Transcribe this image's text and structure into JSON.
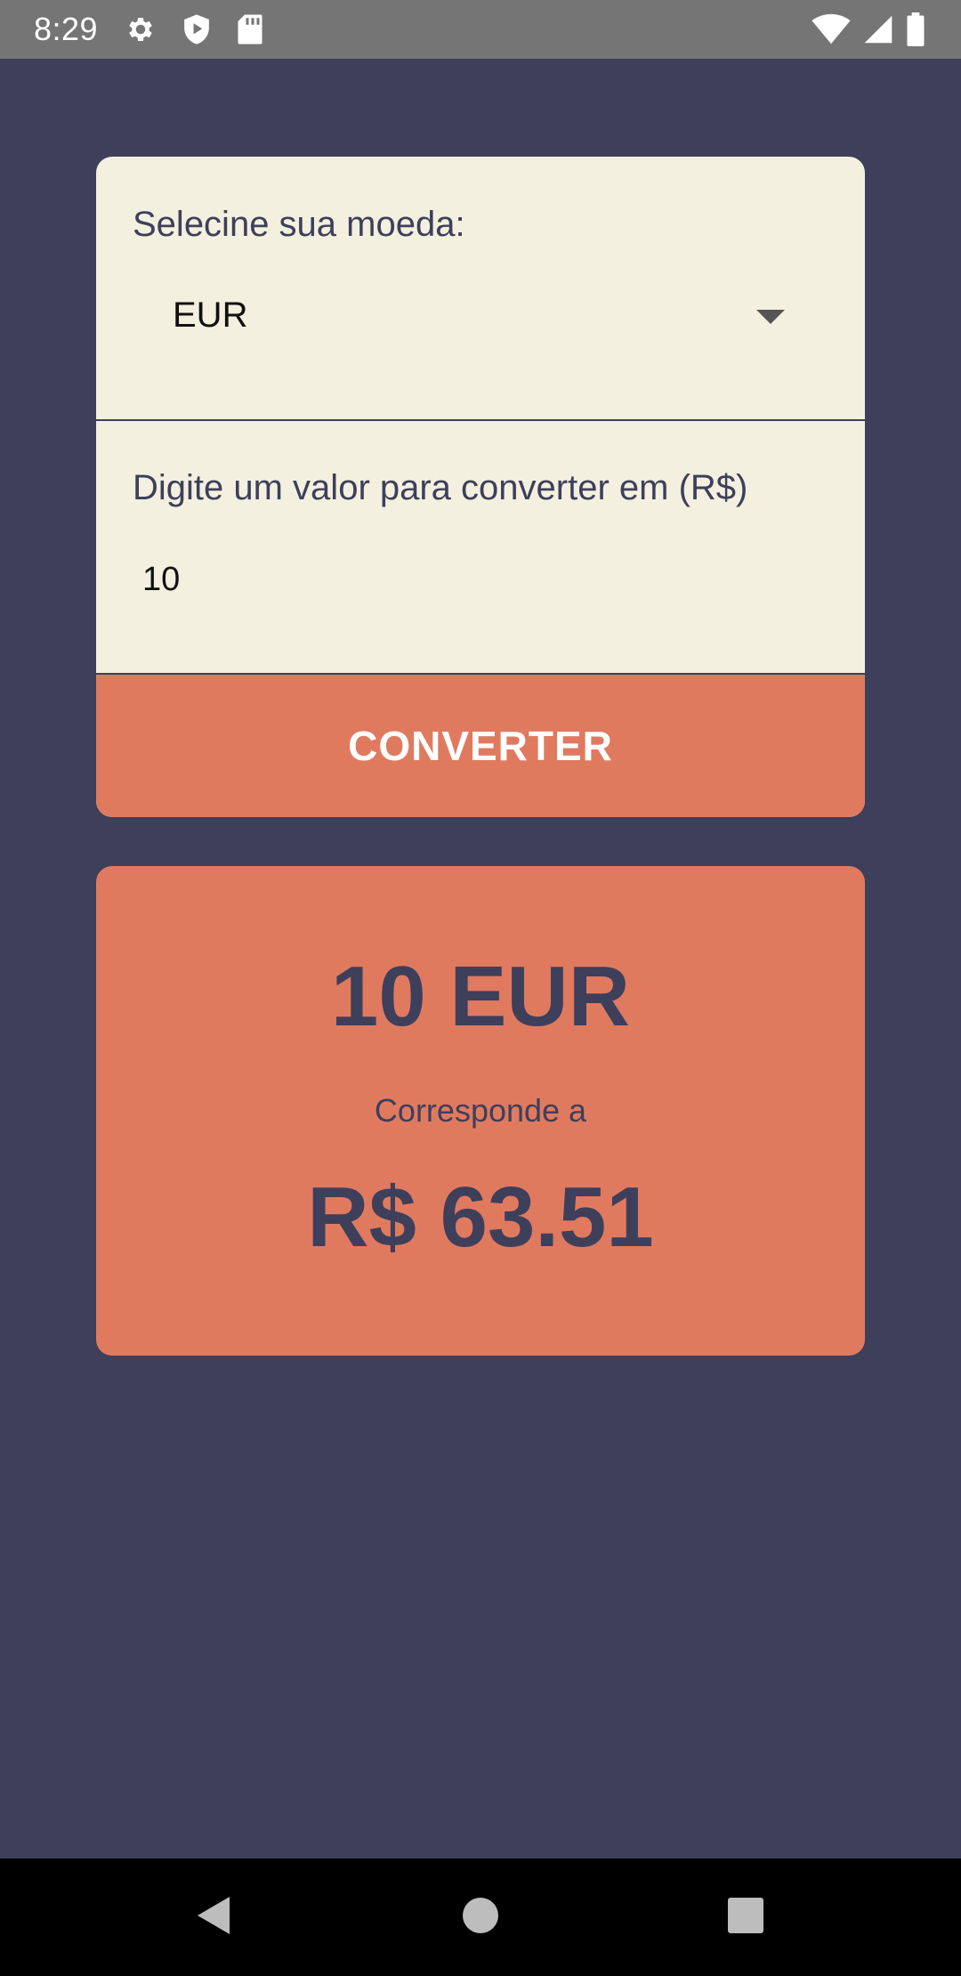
{
  "status_bar": {
    "time": "8:29",
    "left_icons": [
      "gear-icon",
      "shield-play-icon",
      "sd-card-icon"
    ],
    "right_icons": [
      "wifi-icon",
      "signal-icon",
      "battery-icon"
    ]
  },
  "converter": {
    "select_label": "Selecine sua moeda:",
    "selected_currency": "EUR",
    "amount_label": "Digite um valor para converter em (R$)",
    "amount_value": "10",
    "convert_button_label": "CONVERTER"
  },
  "result": {
    "amount_text": "10 EUR",
    "subtitle": "Corresponde a",
    "converted_text": "R$ 63.51"
  },
  "colors": {
    "background": "#3e3f5b",
    "card": "#f3f0df",
    "accent": "#e07a5f",
    "status_bar": "#757575"
  }
}
